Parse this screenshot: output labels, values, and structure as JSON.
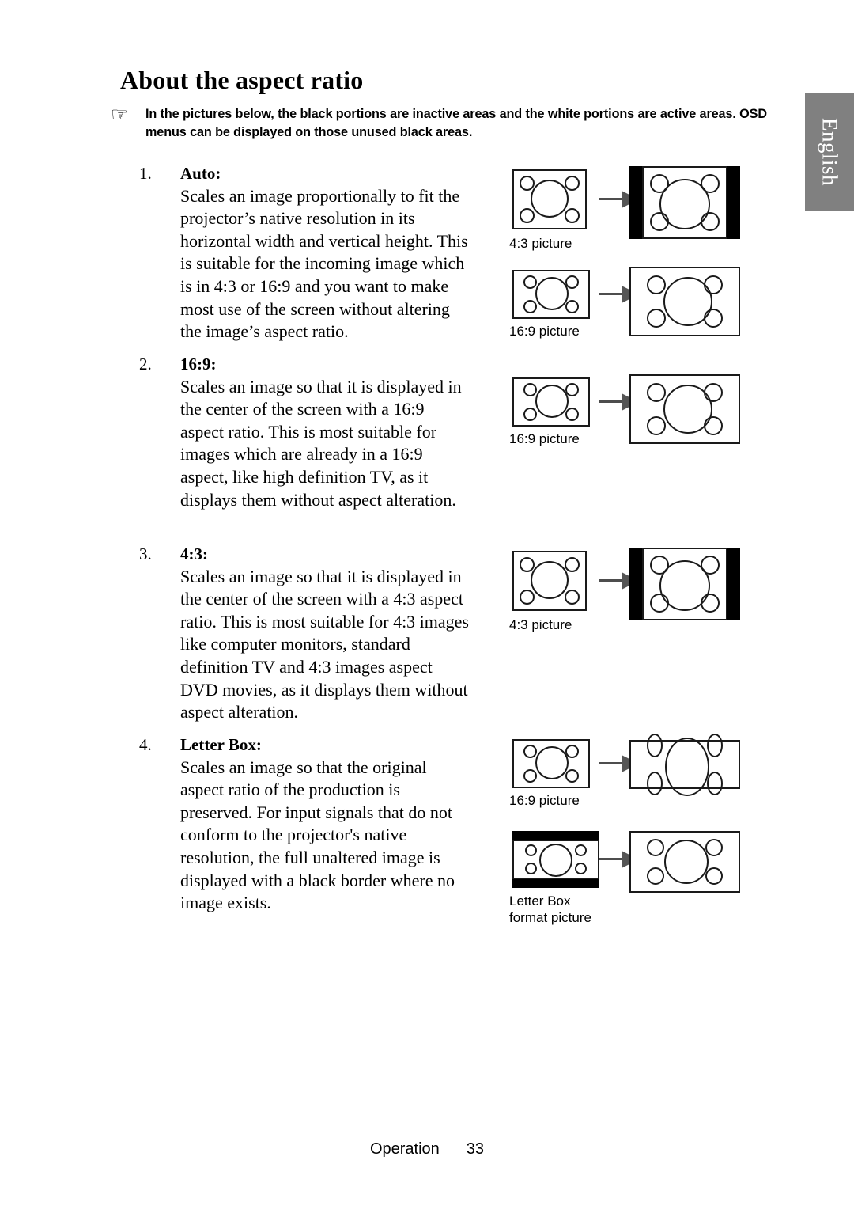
{
  "page": {
    "title": "About the aspect ratio",
    "language_tab": "English",
    "footer": {
      "section": "Operation",
      "page_number": "33"
    },
    "colors": {
      "tab_background": "#808080",
      "tab_text": "#ffffff",
      "ink": "#000000",
      "arrow": "#555555"
    }
  },
  "note": {
    "icon": "pointing-hand-icon",
    "glyph": "☞",
    "text": "In the pictures below, the black portions are inactive areas and the white portions are active areas. OSD menus can be displayed on those unused black areas."
  },
  "items": [
    {
      "number": "1.",
      "term": "Auto:",
      "description": "Scales an image proportionally to fit the projector’s native resolution in its horizontal width and vertical height. This is suitable for the incoming image which is in 4:3 or 16:9 and you want to make most use of the screen without altering the image’s aspect ratio."
    },
    {
      "number": "2.",
      "term": "16:9:",
      "description": "Scales an image so that it is displayed in the center of the screen with a 16:9 aspect ratio. This is most suitable for images which are already in a 16:9 aspect, like high definition TV, as it displays them without aspect alteration."
    },
    {
      "number": "3.",
      "term": "4:3:",
      "description": "Scales an image so that it is displayed in the center of the screen with a 4:3 aspect ratio. This is most suitable for 4:3 images like computer monitors, standard definition TV and 4:3 images aspect DVD movies, as it displays them without aspect alteration."
    },
    {
      "number": "4.",
      "term": "Letter Box:",
      "description": "Scales an image so that the original aspect ratio of the production is preserved. For input signals that do not conform to the projector's native resolution, the full unaltered image is displayed with a black border where no image exists."
    }
  ],
  "diagrams": {
    "d1": {
      "source_caption": "4:3 picture",
      "result_bars": "left-right-black"
    },
    "d2": {
      "source_caption": "16:9 picture",
      "result_bars": "none"
    },
    "d3": {
      "source_caption": "16:9 picture",
      "result_bars": "none"
    },
    "d4": {
      "source_caption": "4:3 picture",
      "result_bars": "left-right-black"
    },
    "d5": {
      "source_caption": "16:9 picture",
      "result_bars": "none"
    },
    "d6": {
      "source_caption": "Letter Box\nformat picture",
      "result_bars": "none"
    }
  }
}
